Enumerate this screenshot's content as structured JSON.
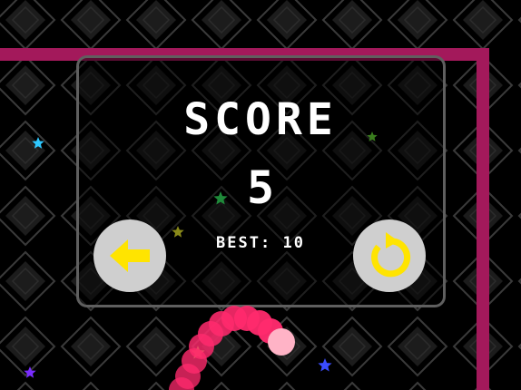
{
  "hud": {
    "score_label": "SCORE",
    "score_value": "5",
    "best_label": "BEST:",
    "best_value": "10"
  },
  "buttons": {
    "back_icon": "left-arrow-icon",
    "restart_icon": "restart-icon"
  },
  "colors": {
    "background": "#000000",
    "wall": "#a3195b",
    "snake": "#ff2a6d",
    "button": "#cfcfcf",
    "button_icon": "#ffe400",
    "panel_border": "#5f5f5f"
  },
  "stars": [
    {
      "color": "#2ec8ff"
    },
    {
      "color": "#3a7d1e"
    },
    {
      "color": "#1f8a3a"
    },
    {
      "color": "#8a8a1a"
    },
    {
      "color": "#7cff3a"
    },
    {
      "color": "#7a2cff"
    },
    {
      "color": "#3a4cff"
    }
  ]
}
